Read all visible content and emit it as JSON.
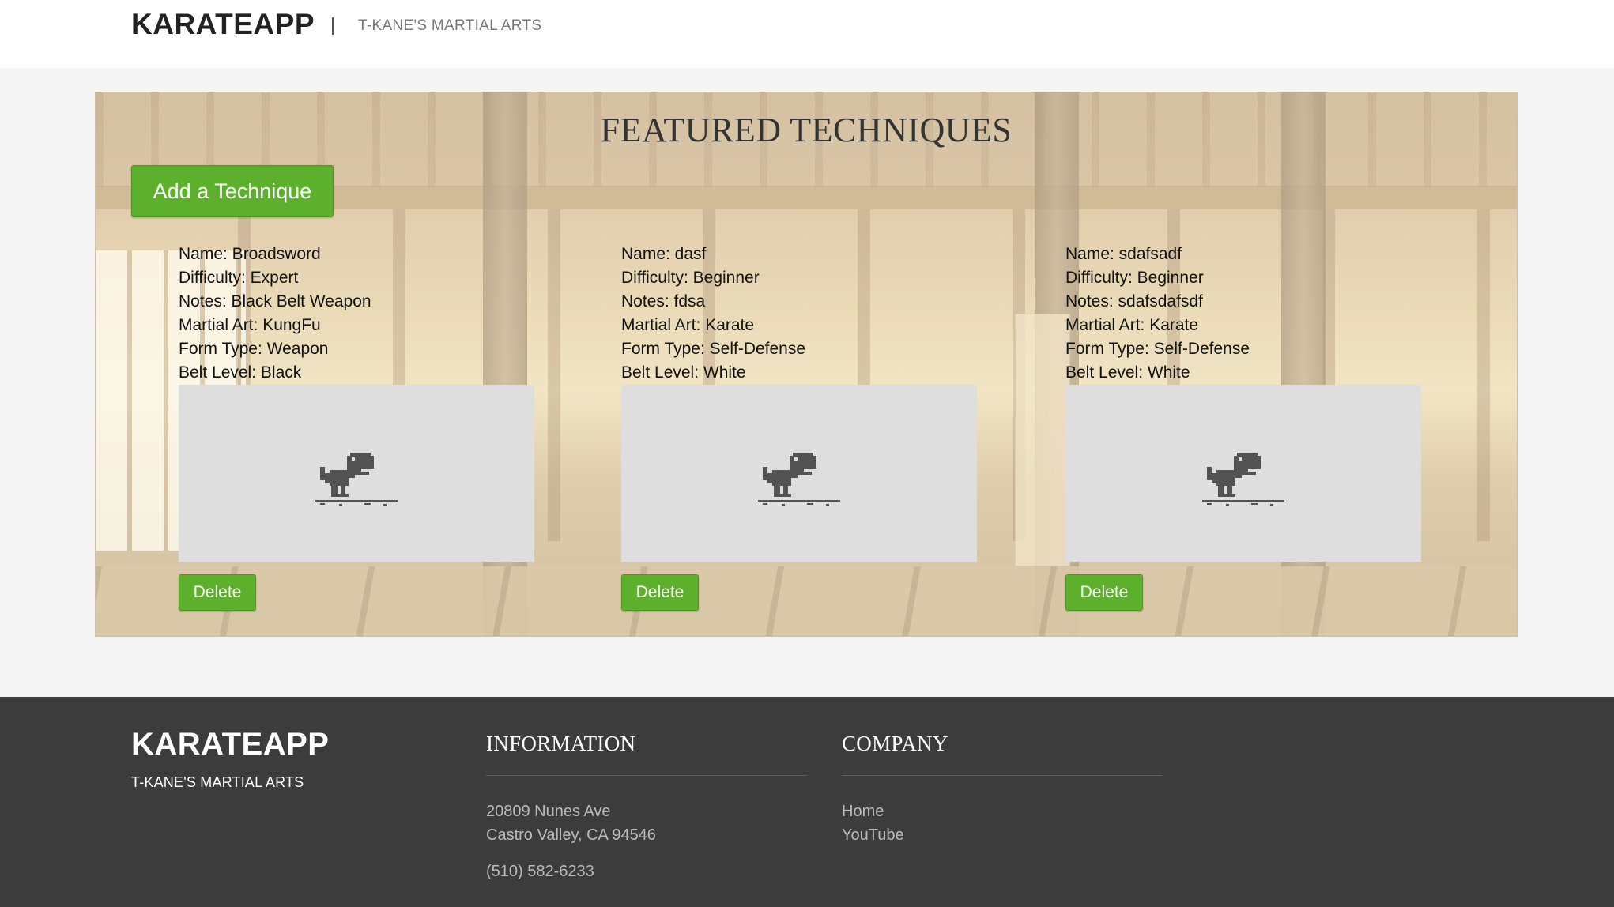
{
  "header": {
    "brand": "KARATEAPP",
    "separator": "|",
    "tagline": "T-KANE'S MARTIAL ARTS"
  },
  "hero": {
    "title": "FEATURED TECHNIQUES",
    "add_button_label": "Add a Technique"
  },
  "techniques": [
    {
      "name": "Name: Broadsword",
      "difficulty": "Difficulty: Expert",
      "notes": "Notes: Black Belt Weapon",
      "martial_art": "Martial Art: KungFu",
      "form_type": "Form Type: Weapon",
      "belt_level": "Belt Level: Black",
      "image_icon": "offline-dino-icon",
      "delete_label": "Delete"
    },
    {
      "name": "Name: dasf",
      "difficulty": "Difficulty: Beginner",
      "notes": "Notes: fdsa",
      "martial_art": "Martial Art: Karate",
      "form_type": "Form Type: Self-Defense",
      "belt_level": "Belt Level: White",
      "image_icon": "offline-dino-icon",
      "delete_label": "Delete"
    },
    {
      "name": "Name: sdafsadf",
      "difficulty": "Difficulty: Beginner",
      "notes": "Notes: sdafsdafsdf",
      "martial_art": "Martial Art: Karate",
      "form_type": "Form Type: Self-Defense",
      "belt_level": "Belt Level: White",
      "image_icon": "offline-dino-icon",
      "delete_label": "Delete"
    }
  ],
  "footer": {
    "brand": "KARATEAPP",
    "tagline": "T-KANE'S MARTIAL ARTS",
    "information": {
      "heading": "INFORMATION",
      "address_line1": "20809 Nunes Ave",
      "address_line2": "Castro Valley, CA 94546",
      "phone": "(510) 582-6233"
    },
    "company": {
      "heading": "COMPANY",
      "links": [
        "Home",
        "YouTube"
      ]
    }
  },
  "colors": {
    "accent_green": "#5cb02c",
    "footer_bg": "#3c3c3c",
    "page_bg": "#f5f5f5"
  }
}
